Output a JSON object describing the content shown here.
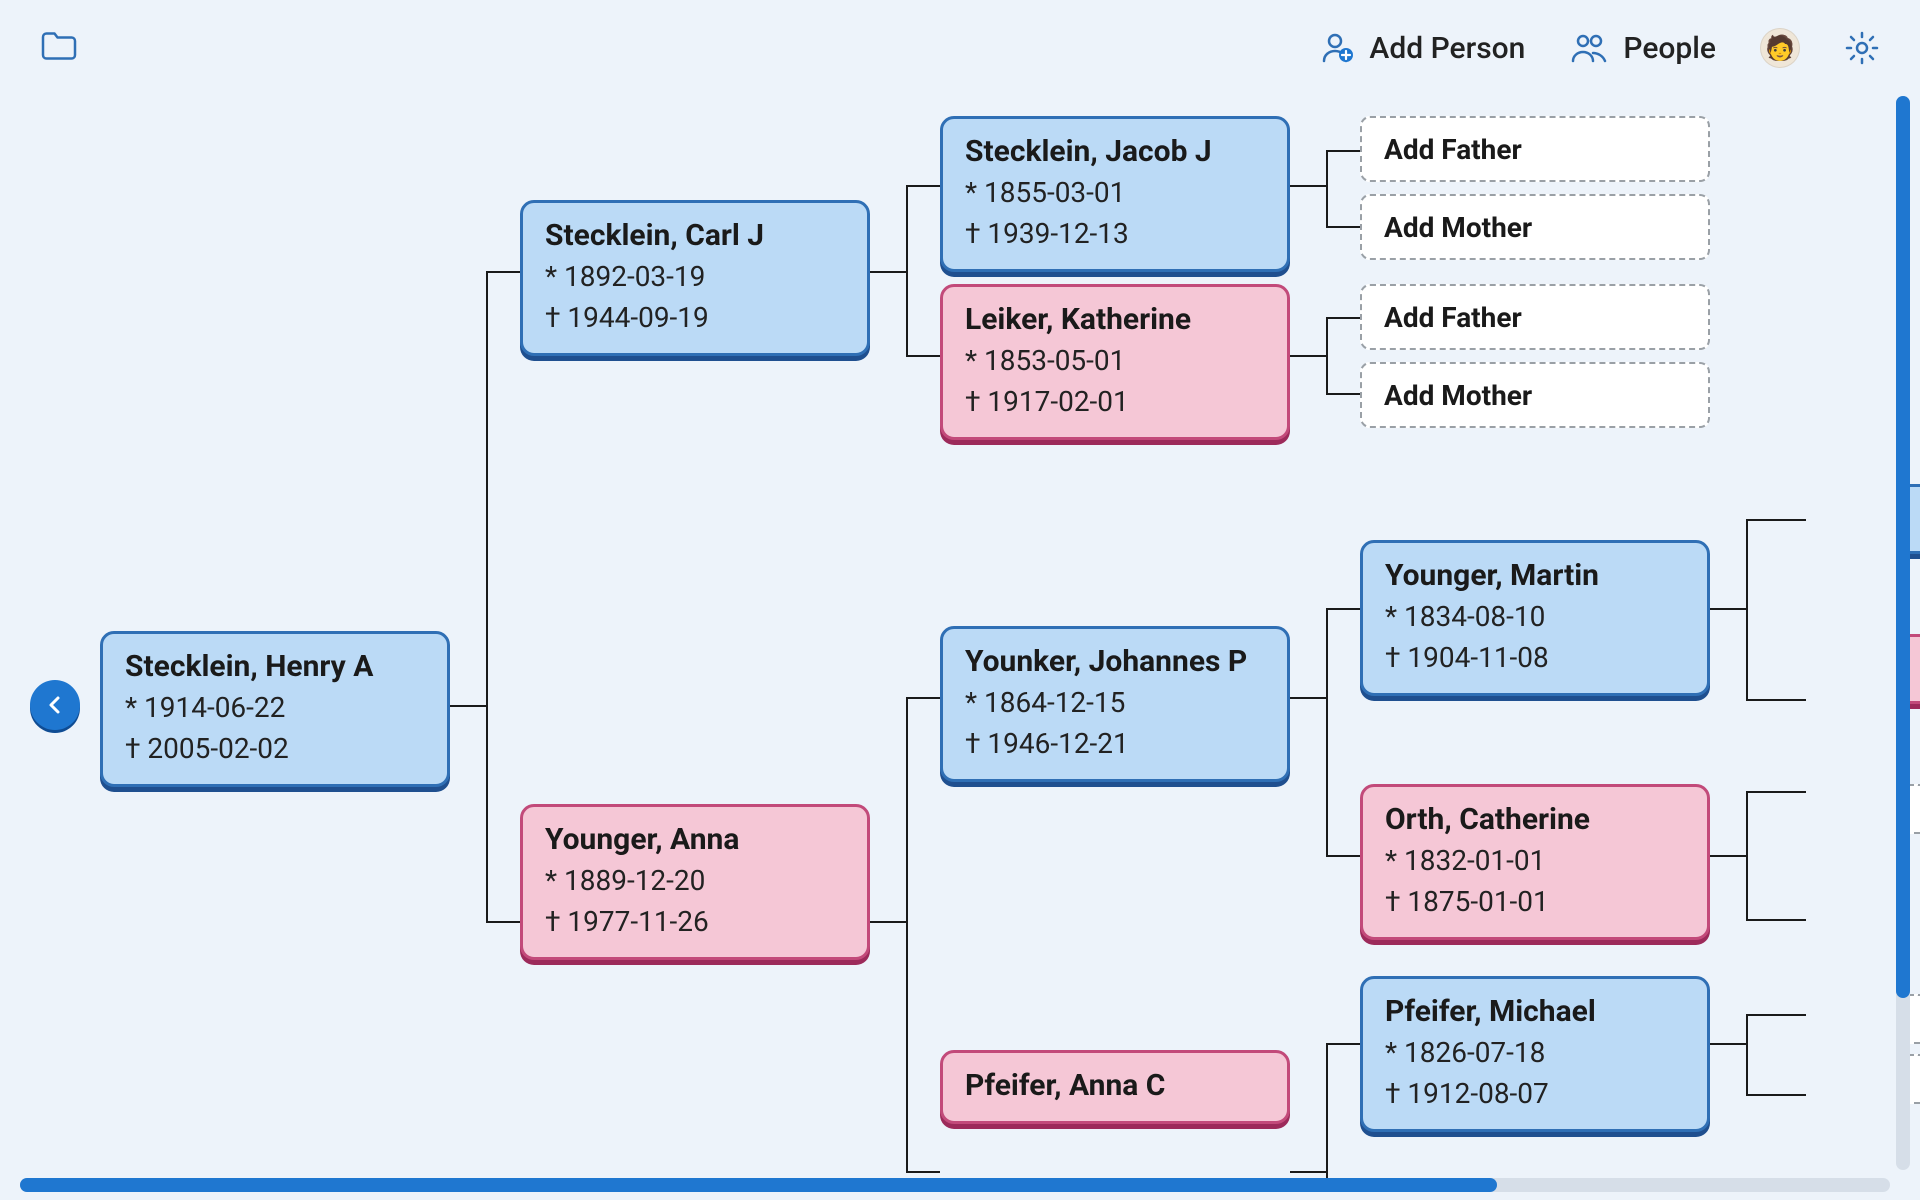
{
  "toolbar": {
    "add_person_label": "Add Person",
    "people_label": "People"
  },
  "actions": {
    "add_father": "Add Father",
    "add_mother": "Add Mother"
  },
  "root": {
    "name": "Stecklein, Henry A",
    "birth": "* 1914-06-22",
    "death": "† 2005-02-02"
  },
  "father": {
    "name": "Stecklein, Carl J",
    "birth": "* 1892-03-19",
    "death": "† 1944-09-19"
  },
  "mother": {
    "name": "Younger, Anna",
    "birth": "* 1889-12-20",
    "death": "† 1977-11-26"
  },
  "pgf": {
    "name": "Stecklein, Jacob J",
    "birth": "* 1855-03-01",
    "death": "† 1939-12-13"
  },
  "pgm": {
    "name": "Leiker, Katherine",
    "birth": "* 1853-05-01",
    "death": "† 1917-02-01"
  },
  "mgf": {
    "name": "Younker, Johannes P",
    "birth": "* 1864-12-15",
    "death": "† 1946-12-21"
  },
  "mgm": {
    "name": "Pfeifer, Anna C"
  },
  "mgf_f": {
    "name": "Younger, Martin",
    "birth": "* 1834-08-10",
    "death": "† 1904-11-08"
  },
  "mgf_m": {
    "name": "Orth, Catherine",
    "birth": "* 1832-01-01",
    "death": "† 1875-01-01"
  },
  "mgm_f": {
    "name": "Pfeifer, Michael",
    "birth": "* 1826-07-18",
    "death": "† 1912-08-07"
  }
}
